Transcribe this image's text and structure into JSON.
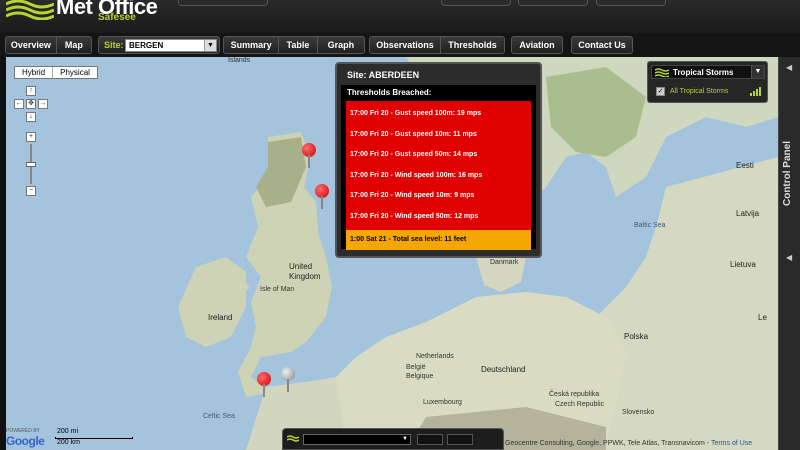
{
  "header": {
    "logo_text": "Met Office",
    "logo_sub": "Safesee"
  },
  "toolbar": {
    "overview_label": "Overview",
    "map_label": "Map",
    "site_label": "Site:",
    "site_value": "BERGEN",
    "summary_label": "Summary",
    "table_label": "Table",
    "graph_label": "Graph",
    "observations_label": "Observations",
    "thresholds_label": "Thresholds",
    "aviation_label": "Aviation",
    "contact_label": "Contact Us"
  },
  "map": {
    "type_hybrid": "Hybrid",
    "type_physical": "Physical",
    "labels": {
      "islands": "Islands",
      "united_kingdom": "United\nKingdom",
      "isle_of_man": "Isle of Man",
      "ireland": "Ireland",
      "celtic_sea": "Celtic Sea",
      "netherlands": "Netherlands",
      "belgie": "België",
      "belgique": "Belgique",
      "luxembourg": "Luxembourg",
      "deutschland": "Deutschland",
      "denmark": "Danmark",
      "baltic_sea": "Baltic Sea",
      "eesti": "Eesti",
      "latvija": "Latvija",
      "lietuva": "Lietuva",
      "polska": "Polska",
      "ceska": "Česká republika",
      "czech": "Czech Republic",
      "slovensko": "Slovensko",
      "le": "Le"
    }
  },
  "popup": {
    "title": "Site: ABERDEEN",
    "subtitle": "Thresholds Breached:",
    "breaches": [
      "17:00 Fri 20 - Gust speed 100m: 19 mps",
      "17:00 Fri 20 - Gust speed 10m: 11 mps",
      "17:00 Fri 20 - Gust speed 50m: 14 mps",
      "17:00 Fri 20 - Wind speed 100m: 16 mps",
      "17:00 Fri 20 - Wind speed 10m: 9 mps",
      "17:00 Fri 20 - Wind speed 50m: 12 mps"
    ],
    "amber": "1:00 Sat 21 - Total sea level: 11 feet"
  },
  "storm_panel": {
    "title": "Tropical Storms",
    "item": "All Tropical Storms"
  },
  "control_panel": {
    "label": "Control Panel"
  },
  "footer": {
    "powered_by": "POWERED BY",
    "google": "Google",
    "scale_mi": "200 mi",
    "scale_km": "200 km",
    "attribution": "Geocentre Consulting, Google, PPWK, Tele Atlas, Transnavicom - ",
    "terms": "Terms of Use"
  },
  "colors": {
    "accent_green": "#b4d433",
    "breach_red": "#e00000",
    "breach_amber": "#f5a700",
    "pin_red": "#cc1111"
  }
}
